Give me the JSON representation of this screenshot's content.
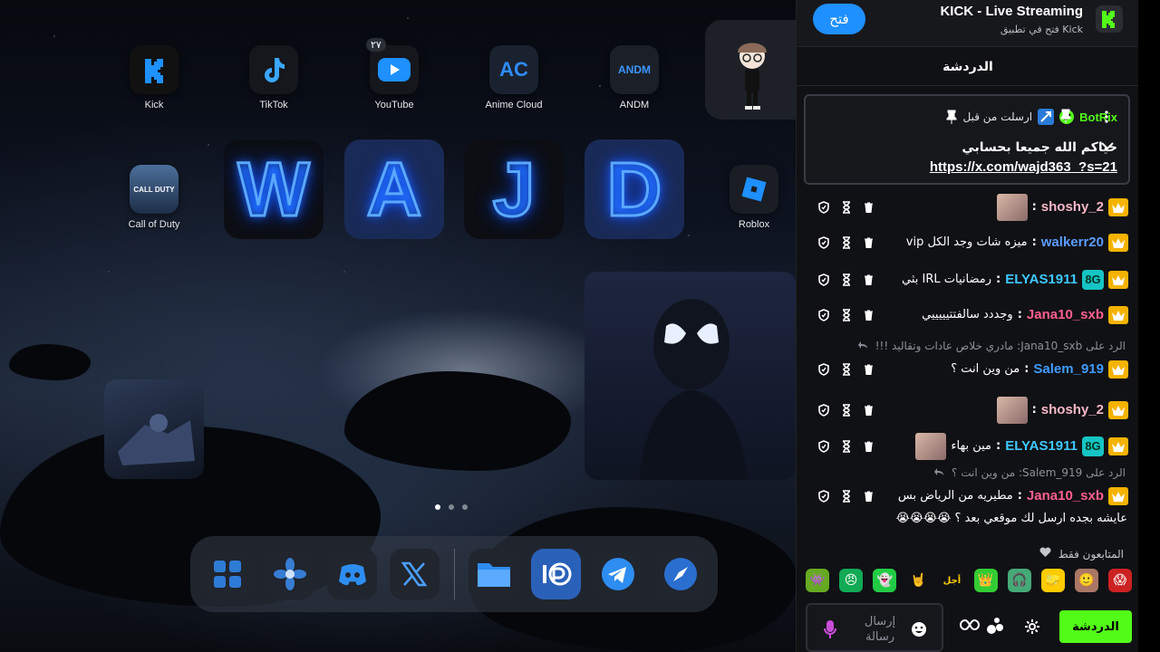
{
  "home": {
    "apps_row1": [
      {
        "label": "Kick",
        "icon": "kick-app-icon"
      },
      {
        "label": "TikTok",
        "icon": "tiktok-app-icon"
      },
      {
        "label": "YouTube",
        "icon": "youtube-app-icon",
        "badge": "٢٧"
      },
      {
        "label": "Anime Cloud",
        "icon": "anime-cloud-app-icon"
      },
      {
        "label": "ANDM",
        "icon": "andm-app-icon"
      }
    ],
    "apps_row2": [
      {
        "label": "Call of Duty",
        "icon": "call-of-duty-app-icon"
      },
      {
        "label": "Roblox",
        "icon": "roblox-app-icon"
      }
    ],
    "neon_letters": [
      "W",
      "A",
      "J",
      "D"
    ],
    "icon_glyphs": {
      "anime_cloud": "AC",
      "andm": "ANDM",
      "cod": "CALL DUTY"
    },
    "dock": [
      "app-library-icon",
      "photos-icon",
      "discord-icon",
      "x-icon",
      "files-icon",
      "ibis-paint-icon",
      "telegram-icon",
      "safari-icon"
    ]
  },
  "panel": {
    "open_button": "فتح",
    "app_title": "KICK - Live Streaming",
    "app_subtitle": "فتح في تطبيق Kick",
    "chat_header": "الدردشة",
    "pinned": {
      "sent_by": "ارسلت من قبل",
      "username": "BotRix",
      "line1": "حياكم الله جميعا بحسابي",
      "link": "https://x.com/wajd363_?s=21"
    },
    "messages": [
      {
        "user": "shoshy_2",
        "user_color": "#f7b7c7",
        "text": "",
        "avatar": true,
        "tag8": false
      },
      {
        "user": "walkerr20",
        "user_color": "#5b9cff",
        "text": "ميزه شات وجد الكل vip",
        "avatar": false,
        "tag8": false
      },
      {
        "user": "ELYAS1911",
        "user_color": "#3ec8ff",
        "text": "رمضانيات IRL بثي",
        "avatar": false,
        "tag8": true
      },
      {
        "user": "Jana10_sxb",
        "user_color": "#ff5f8f",
        "text": "وجددد سالفتتيييييي",
        "avatar": false,
        "tag8": false
      },
      {
        "user": "Salem_919",
        "user_color": "#3e9bff",
        "text": "من وين انت ؟",
        "avatar": false,
        "tag8": false
      },
      {
        "user": "shoshy_2",
        "user_color": "#f7b7c7",
        "text": "",
        "avatar": true,
        "tag8": false
      },
      {
        "user": "ELYAS1911",
        "user_color": "#3ec8ff",
        "text": "مين بهاء",
        "avatar": true,
        "tag8": true
      },
      {
        "user": "Jana10_sxb",
        "user_color": "#ff5f8f",
        "text": "مطيريه من الرياض بس",
        "avatar": false,
        "tag8": false
      }
    ],
    "replies": [
      "الرد على Jana10_sxb: مادري خلاص عادات وتقاليد !!!",
      "الرد على Salem_919: من وين انت ؟"
    ],
    "last_line": "عايشه بجده ارسل لك موقعي بعد ؟ 😭😭😭😭",
    "followers_only": "المتابعون فقط",
    "send_placeholder": "إرسال رسالة",
    "chat_button": "الدردشة",
    "colors": {
      "kick_green": "#53fc18",
      "open_blue": "#1e90ff",
      "crown_gold": "#f5b300"
    }
  }
}
